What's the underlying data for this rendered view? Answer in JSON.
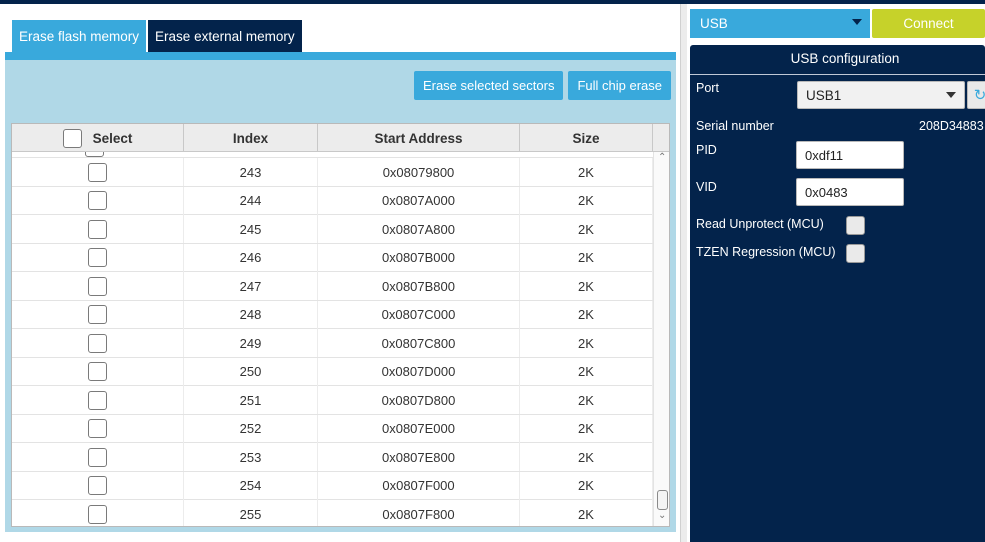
{
  "tabs": [
    {
      "label": "Erase flash memory",
      "active": true
    },
    {
      "label": "Erase external memory",
      "active": false
    }
  ],
  "actions": {
    "erase_selected": "Erase selected sectors",
    "full_chip_erase": "Full chip erase"
  },
  "table": {
    "columns": [
      "Select",
      "Index",
      "Start Address",
      "Size"
    ],
    "rows": [
      {
        "index": "243",
        "address": "0x08079800",
        "size": "2K",
        "checked": false
      },
      {
        "index": "244",
        "address": "0x0807A000",
        "size": "2K",
        "checked": false
      },
      {
        "index": "245",
        "address": "0x0807A800",
        "size": "2K",
        "checked": false
      },
      {
        "index": "246",
        "address": "0x0807B000",
        "size": "2K",
        "checked": false
      },
      {
        "index": "247",
        "address": "0x0807B800",
        "size": "2K",
        "checked": false
      },
      {
        "index": "248",
        "address": "0x0807C000",
        "size": "2K",
        "checked": false
      },
      {
        "index": "249",
        "address": "0x0807C800",
        "size": "2K",
        "checked": false
      },
      {
        "index": "250",
        "address": "0x0807D000",
        "size": "2K",
        "checked": false
      },
      {
        "index": "251",
        "address": "0x0807D800",
        "size": "2K",
        "checked": false
      },
      {
        "index": "252",
        "address": "0x0807E000",
        "size": "2K",
        "checked": false
      },
      {
        "index": "253",
        "address": "0x0807E800",
        "size": "2K",
        "checked": false
      },
      {
        "index": "254",
        "address": "0x0807F000",
        "size": "2K",
        "checked": false
      },
      {
        "index": "255",
        "address": "0x0807F800",
        "size": "2K",
        "checked": false
      }
    ]
  },
  "connection": {
    "interface": "USB",
    "connect_label": "Connect"
  },
  "usb_config": {
    "title": "USB configuration",
    "port_label": "Port",
    "port_value": "USB1",
    "serial_label": "Serial number",
    "serial_value": "208D34883",
    "pid_label": "PID",
    "pid_value": "0xdf11",
    "vid_label": "VID",
    "vid_value": "0x0483",
    "read_unprotect_label": "Read Unprotect (MCU)",
    "tzen_label": "TZEN Regression (MCU)"
  },
  "icons": {
    "refresh": "refresh-icon",
    "dropdown": "chevron-down-icon",
    "scroll_up": "scroll-up-icon",
    "scroll_down": "scroll-down-icon"
  },
  "colors": {
    "accent": "#39a9dc",
    "navy": "#03234b",
    "connect": "#c6d22a",
    "content_bg": "#b0d8e7"
  }
}
